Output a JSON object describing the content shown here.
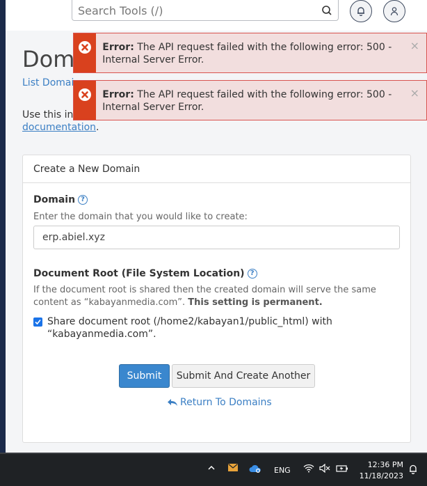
{
  "header": {
    "search_placeholder": "Search Tools (/)"
  },
  "page": {
    "title": "Doma",
    "breadcrumb": "List Domain",
    "intro_text": "Use this int",
    "doc_link": "documentation",
    "doc_link_suffix": "."
  },
  "alerts": [
    {
      "label": "Error:",
      "message": "The API request failed with the following error: 500 - Internal Server Error.",
      "close": "×"
    },
    {
      "label": "Error:",
      "message": "The API request failed with the following error: 500 - Internal Server Error.",
      "close": "×"
    }
  ],
  "form": {
    "panel_title": "Create a New Domain",
    "domain_label": "Domain",
    "domain_help": "Enter the domain that you would like to create:",
    "domain_value": "erp.abiel.xyz",
    "docroot_label": "Document Root (File System Location)",
    "docroot_help": "If the document root is shared then the created domain will serve the same content as “kabayanmedia.com”.",
    "docroot_help_bold": "This setting is permanent.",
    "share_checked": true,
    "share_label": "Share document root (/home2/kabayan1/public_html) with “kabayanmedia.com”.",
    "submit_label": "Submit",
    "submit_another_label": "Submit And Create Another",
    "return_label": "Return To Domains"
  },
  "taskbar": {
    "language": "ENG",
    "time": "12:36 PM",
    "date": "11/18/2023"
  },
  "colors": {
    "accent": "#3a87ce",
    "error_icon_bg": "#d9411e",
    "error_bg": "#f2dede"
  }
}
